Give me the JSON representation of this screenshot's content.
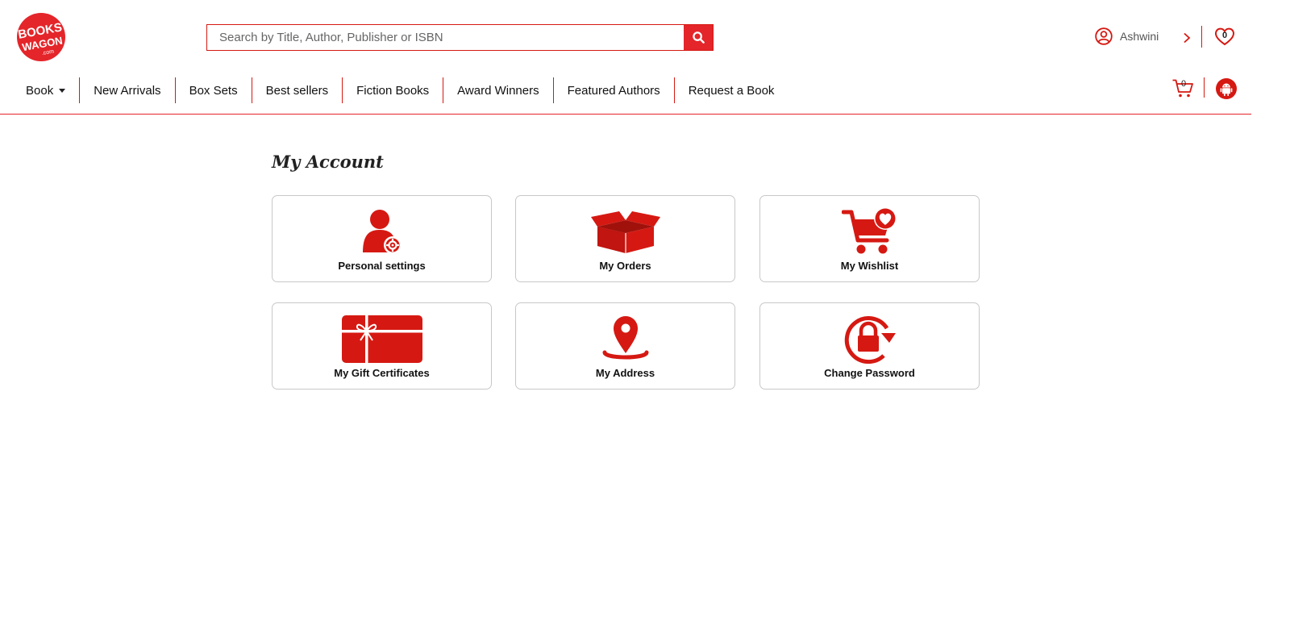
{
  "brand": {
    "logo_top": "BOOKS",
    "logo_bottom": "WAGON",
    "logo_suffix": ".com",
    "accent_color": "#e4252a"
  },
  "search": {
    "placeholder": "Search by Title, Author, Publisher or ISBN",
    "value": "",
    "icon": "search-icon"
  },
  "user": {
    "name": "Ashwini",
    "icon": "user-circle-icon"
  },
  "wishlist": {
    "count": "0",
    "icon": "heart-icon"
  },
  "cart": {
    "count": "0",
    "icon": "cart-icon"
  },
  "android": {
    "icon": "android-icon"
  },
  "nav": {
    "items": [
      {
        "label": "Book"
      },
      {
        "label": "New Arrivals"
      },
      {
        "label": "Box Sets"
      },
      {
        "label": "Best sellers"
      },
      {
        "label": "Fiction Books"
      },
      {
        "label": "Award Winners"
      },
      {
        "label": "Featured Authors"
      },
      {
        "label": "Request a Book"
      }
    ]
  },
  "account": {
    "title": "My Account",
    "cards": [
      {
        "label": "Personal settings",
        "icon": "user-settings-icon"
      },
      {
        "label": "My Orders",
        "icon": "open-box-icon"
      },
      {
        "label": "My Wishlist",
        "icon": "cart-heart-icon"
      },
      {
        "label": "My Gift Certificates",
        "icon": "gift-card-icon"
      },
      {
        "label": "My Address",
        "icon": "map-pin-icon"
      },
      {
        "label": "Change Password",
        "icon": "lock-refresh-icon"
      }
    ]
  }
}
